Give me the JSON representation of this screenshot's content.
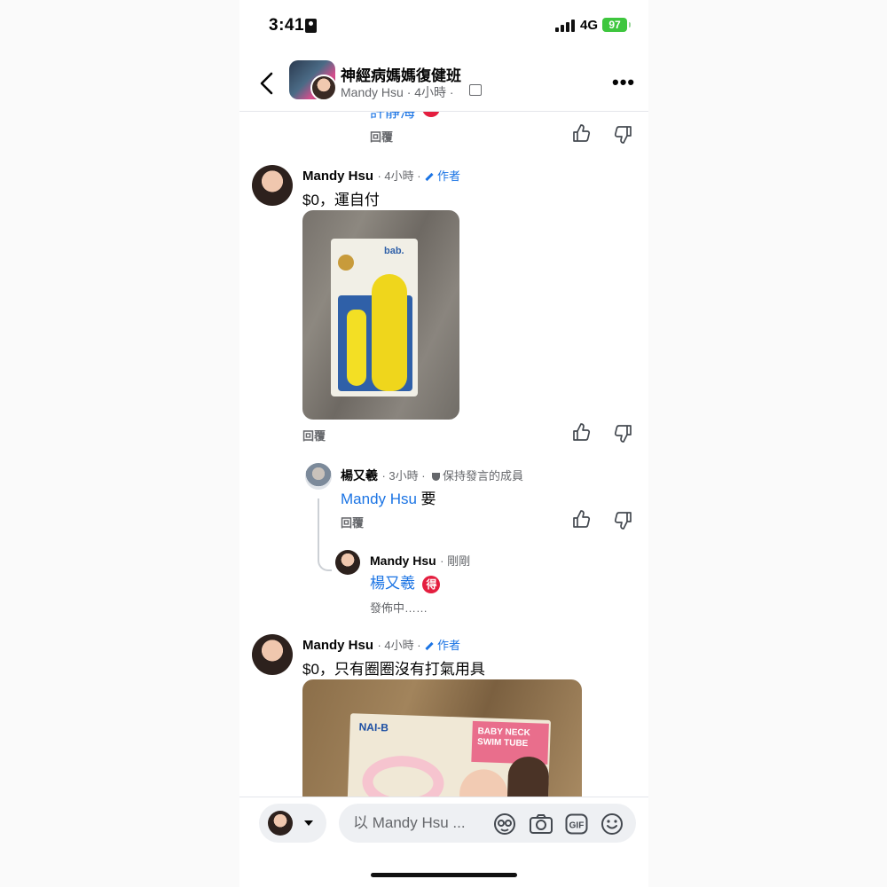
{
  "status_bar": {
    "time": "3:41",
    "network": "4G",
    "battery": "97"
  },
  "header": {
    "group_name": "神經病媽媽復健班",
    "subtitle": "Mandy Hsu · 4小時 ·",
    "more": "•••"
  },
  "clipped": {
    "name": "許靜海",
    "reply": "回覆"
  },
  "comment1": {
    "name": "Mandy Hsu",
    "time": "· 4小時 ·",
    "author_tag": "作者",
    "text": "$0，運自付",
    "photo_brand": "bab.",
    "reply": "回覆"
  },
  "reply1": {
    "name": "楊又羲",
    "time": "· 3小時 ·",
    "badge": "保持發言的成員",
    "mention": "Mandy Hsu",
    "text": "要",
    "reply": "回覆"
  },
  "reply2": {
    "name": "Mandy Hsu",
    "time": "· 剛剛",
    "mention": "楊又羲",
    "badge": "得",
    "status": "發佈中……"
  },
  "comment2": {
    "name": "Mandy Hsu",
    "time": "· 4小時 ·",
    "author_tag": "作者",
    "text": "$0，只有圈圈沒有打氣用具",
    "photo_brand": "NAI-B",
    "photo_title": "BABY NECK SWIM TUBE"
  },
  "composer": {
    "placeholder": "以 Mandy Hsu ..."
  },
  "colors": {
    "link": "#1b74e4",
    "badge_red": "#e41e3f",
    "battery": "#3ec63e",
    "meta": "#65676b"
  }
}
